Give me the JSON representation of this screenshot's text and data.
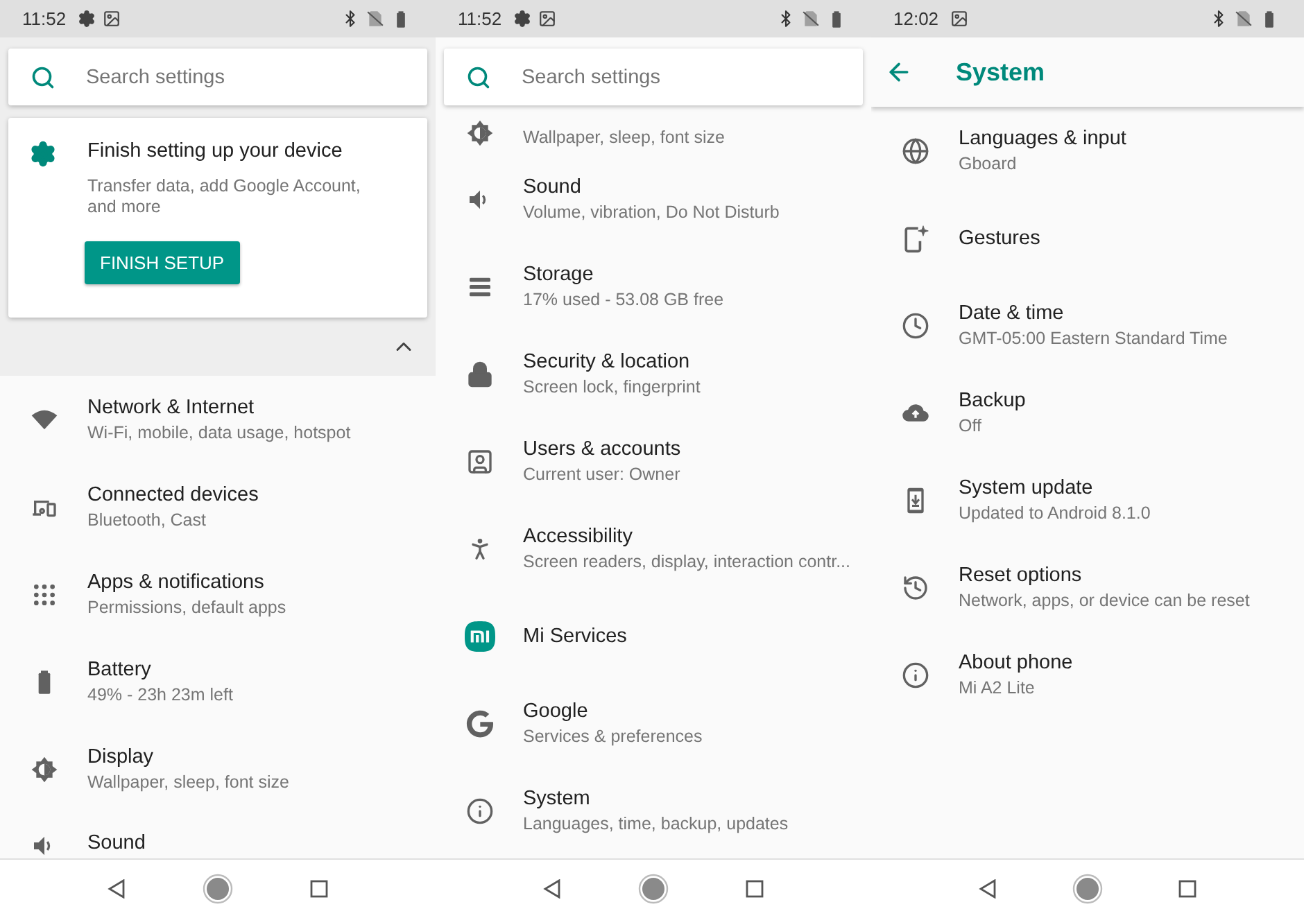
{
  "screens": [
    {
      "status_bar": {
        "time": "11:52"
      },
      "search": {
        "placeholder": "Search settings"
      },
      "suggestion_card": {
        "title": "Finish setting up your device",
        "text": "Transfer data, add Google Account, and more",
        "button": "FINISH SETUP"
      },
      "suggestions": {
        "expanded": true
      },
      "items": [
        {
          "title": "Network & Internet",
          "subtitle": "Wi-Fi, mobile, data usage, hotspot"
        },
        {
          "title": "Connected devices",
          "subtitle": "Bluetooth, Cast"
        },
        {
          "title": "Apps & notifications",
          "subtitle": "Permissions, default apps"
        },
        {
          "title": "Battery",
          "subtitle": "49% - 23h 23m left"
        },
        {
          "title": "Display",
          "subtitle": "Wallpaper, sleep, font size"
        },
        {
          "title": "Sound"
        }
      ]
    },
    {
      "status_bar": {
        "time": "11:52"
      },
      "search": {
        "placeholder": "Search settings"
      },
      "items": [
        {
          "subtitle": "Wallpaper, sleep, font size"
        },
        {
          "title": "Sound",
          "subtitle": "Volume, vibration, Do Not Disturb"
        },
        {
          "title": "Storage",
          "subtitle": "17% used - 53.08 GB free"
        },
        {
          "title": "Security & location",
          "subtitle": "Screen lock, fingerprint"
        },
        {
          "title": "Users & accounts",
          "subtitle": "Current user: Owner"
        },
        {
          "title": "Accessibility",
          "subtitle": "Screen readers, display, interaction contr..."
        },
        {
          "title": "Mi Services"
        },
        {
          "title": "Google",
          "subtitle": "Services & preferences"
        },
        {
          "title": "System",
          "subtitle": "Languages, time, backup, updates"
        }
      ]
    },
    {
      "status_bar": {
        "time": "12:02"
      },
      "toolbar": {
        "title": "System"
      },
      "items": [
        {
          "title": "Languages & input",
          "subtitle": "Gboard"
        },
        {
          "title": "Gestures"
        },
        {
          "title": "Date & time",
          "subtitle": "GMT-05:00 Eastern Standard Time"
        },
        {
          "title": "Backup",
          "subtitle": "Off"
        },
        {
          "title": "System update",
          "subtitle": "Updated to Android 8.1.0"
        },
        {
          "title": "Reset options",
          "subtitle": "Network, apps, or device can be reset"
        },
        {
          "title": "About phone",
          "subtitle": "Mi A2 Lite"
        }
      ]
    }
  ]
}
